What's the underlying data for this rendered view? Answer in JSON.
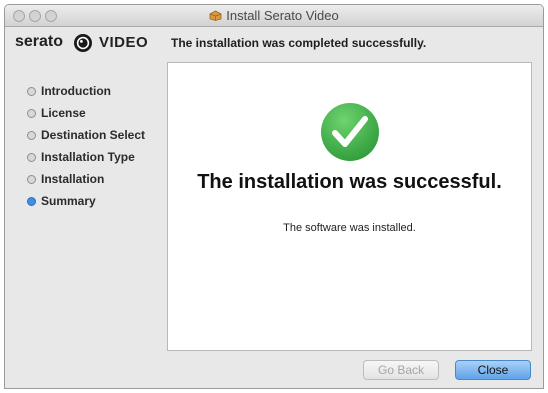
{
  "window": {
    "title": "Install Serato Video"
  },
  "header": {
    "brand_name": "serato",
    "brand_product": "VIDEO",
    "message": "The installation was completed successfully."
  },
  "sidebar": {
    "steps": [
      {
        "label": "Introduction",
        "active": false
      },
      {
        "label": "License",
        "active": false
      },
      {
        "label": "Destination Select",
        "active": false
      },
      {
        "label": "Installation Type",
        "active": false
      },
      {
        "label": "Installation",
        "active": false
      },
      {
        "label": "Summary",
        "active": true
      }
    ]
  },
  "main": {
    "headline": "The installation was successful.",
    "detail": "The software was installed."
  },
  "buttons": {
    "back_label": "Go Back",
    "close_label": "Close"
  },
  "colors": {
    "success_green": "#3cb44a",
    "active_step_blue": "#3d8fe6",
    "default_button_blue": "#5fa3e8"
  },
  "icons": {
    "title": "package-icon",
    "success": "checkmark-circle-icon",
    "brand": "serato-record-icon"
  }
}
